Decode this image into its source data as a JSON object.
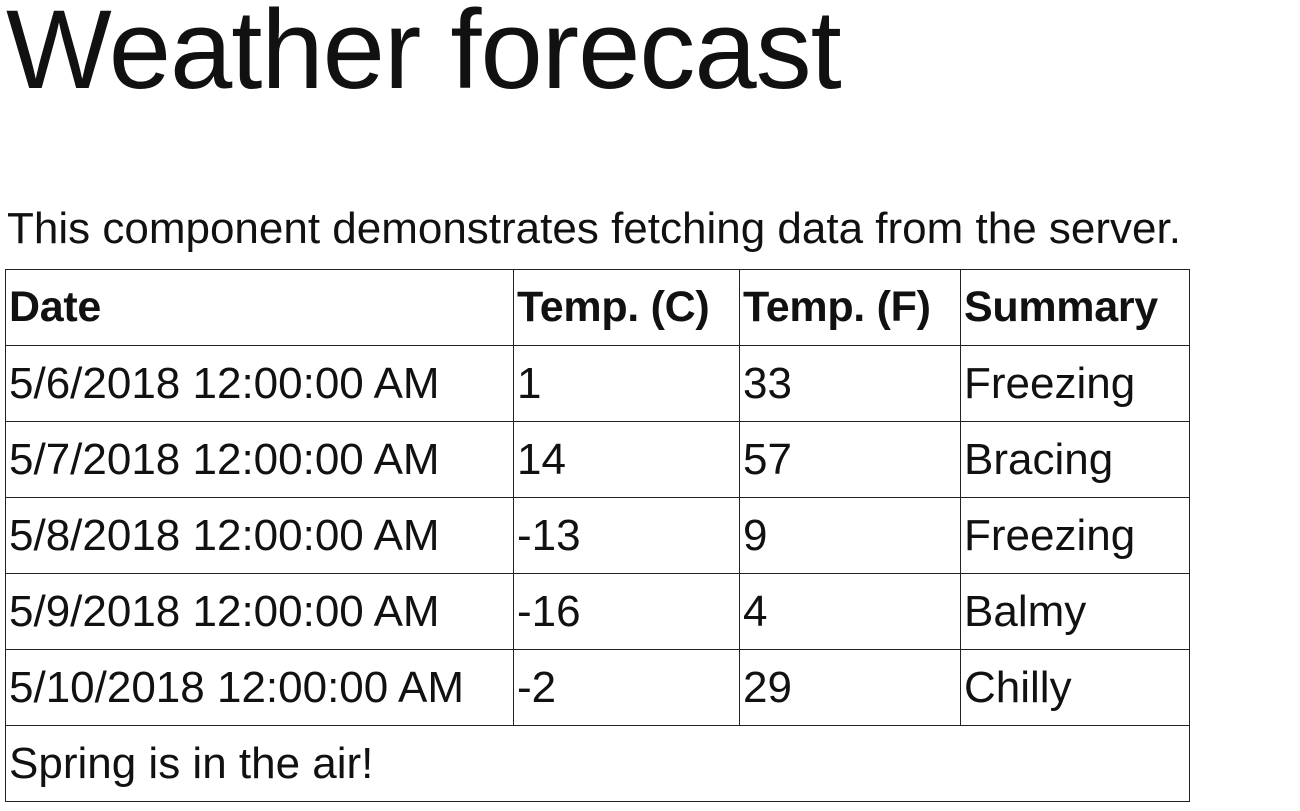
{
  "page": {
    "title": "Weather forecast",
    "description": "This component demonstrates fetching data from the server."
  },
  "table": {
    "headers": {
      "date": "Date",
      "temp_c": "Temp. (C)",
      "temp_f": "Temp. (F)",
      "summary": "Summary"
    },
    "rows": [
      {
        "date": "5/6/2018 12:00:00 AM",
        "temp_c": "1",
        "temp_f": "33",
        "summary": "Freezing"
      },
      {
        "date": "5/7/2018 12:00:00 AM",
        "temp_c": "14",
        "temp_f": "57",
        "summary": "Bracing"
      },
      {
        "date": "5/8/2018 12:00:00 AM",
        "temp_c": "-13",
        "temp_f": "9",
        "summary": "Freezing"
      },
      {
        "date": "5/9/2018 12:00:00 AM",
        "temp_c": "-16",
        "temp_f": "4",
        "summary": "Balmy"
      },
      {
        "date": "5/10/2018 12:00:00 AM",
        "temp_c": "-2",
        "temp_f": "29",
        "summary": "Chilly"
      }
    ],
    "footer": "Spring is in the air!"
  }
}
